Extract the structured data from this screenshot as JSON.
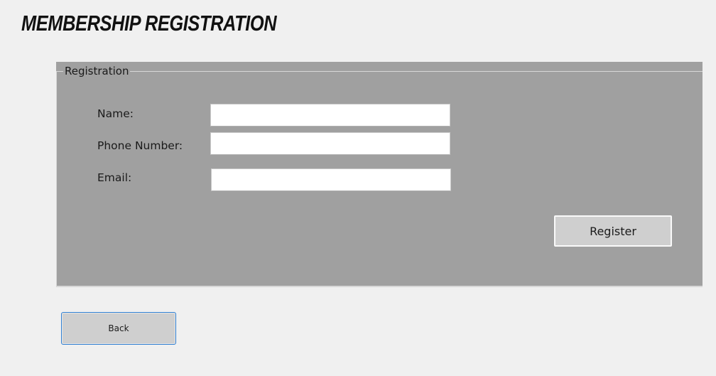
{
  "page": {
    "title": "MEMBERSHIP REGISTRATION"
  },
  "registration": {
    "legend": "Registration",
    "fields": [
      {
        "label": "Name:",
        "value": "",
        "placeholder": ""
      },
      {
        "label": "Phone Number:",
        "value": "",
        "placeholder": ""
      },
      {
        "label": "Email:",
        "value": "",
        "placeholder": ""
      }
    ],
    "register_label": "Register"
  },
  "footer": {
    "back_label": "Back"
  },
  "colors": {
    "window_background": "#f0f0f0",
    "group_background": "#a0a0a0",
    "button_face": "#cfcfcf",
    "focus_border": "#2f7fd2"
  }
}
